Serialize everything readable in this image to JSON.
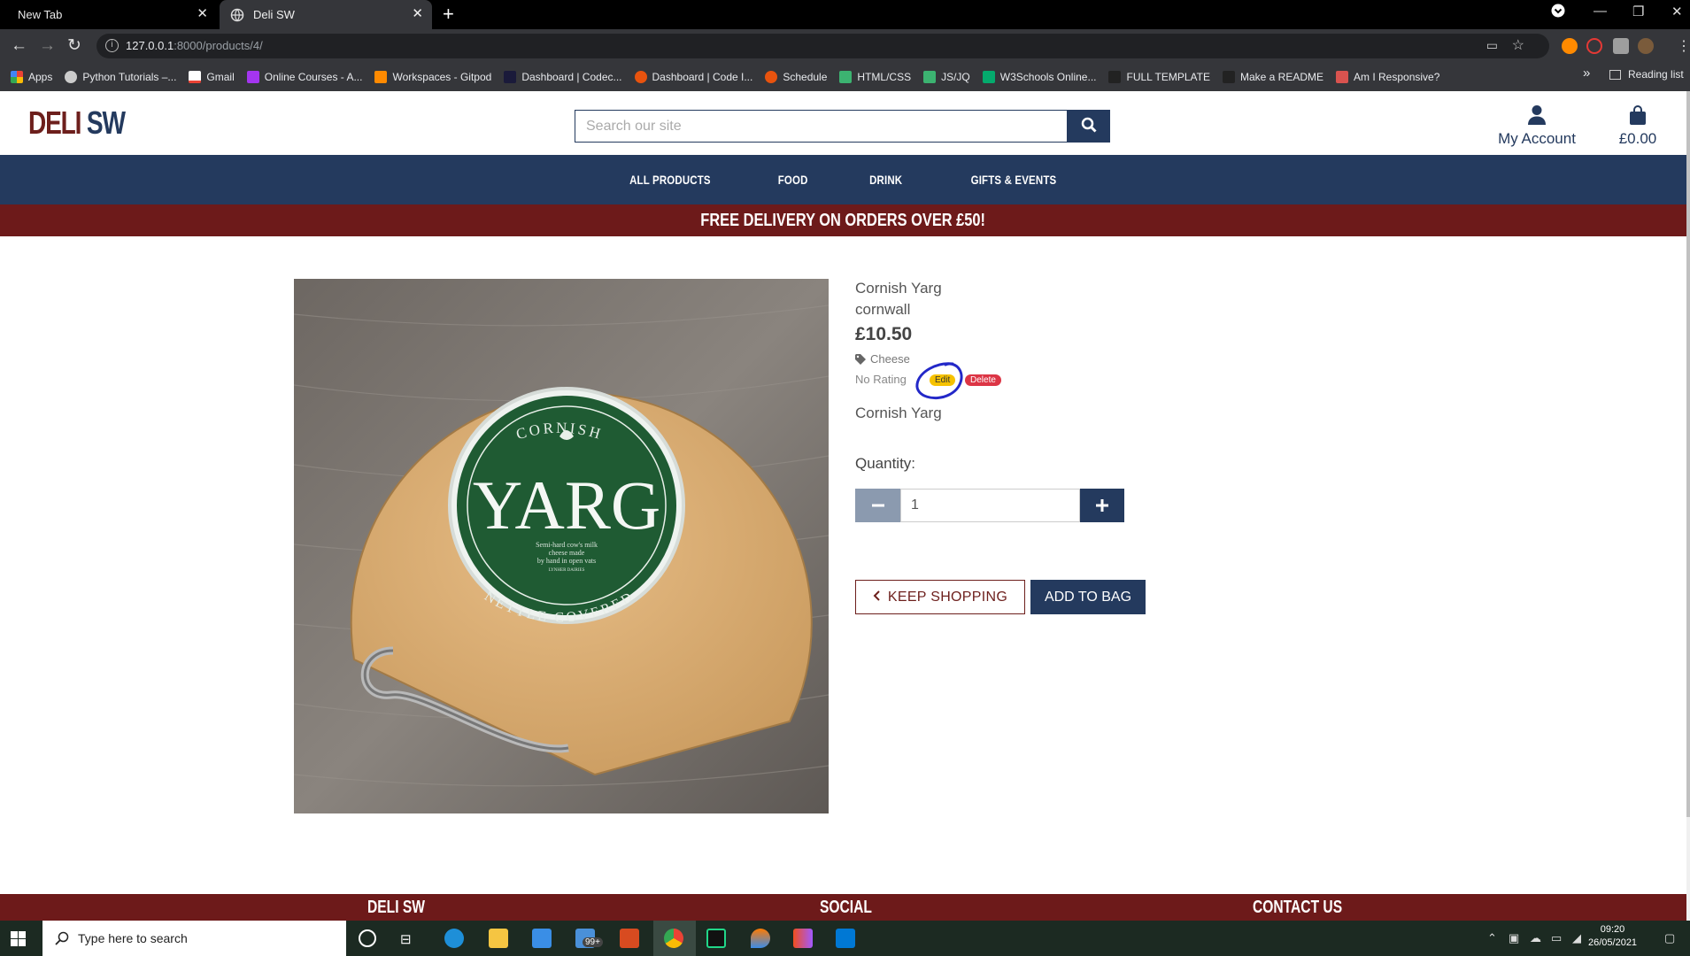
{
  "browser": {
    "tabs": [
      {
        "title": "New Tab"
      },
      {
        "title": "Deli SW"
      }
    ],
    "url_host": "127.0.0.1",
    "url_rest": ":8000/products/4/",
    "bookmarks": [
      {
        "label": "Apps",
        "color": "#4285f4"
      },
      {
        "label": "Python Tutorials –...",
        "color": "#cccccc"
      },
      {
        "label": "Gmail",
        "color": "#ea4335"
      },
      {
        "label": "Online Courses - A...",
        "color": "#a435f0"
      },
      {
        "label": "Workspaces - Gitpod",
        "color": "#ff8a00"
      },
      {
        "label": "Dashboard | Codec...",
        "color": "#1a1a3a"
      },
      {
        "label": "Dashboard | Code I...",
        "color": "#e8530e"
      },
      {
        "label": "Schedule",
        "color": "#e8530e"
      },
      {
        "label": "HTML/CSS",
        "color": "#3cb371"
      },
      {
        "label": "JS/JQ",
        "color": "#3cb371"
      },
      {
        "label": "W3Schools Online...",
        "color": "#04aa6d"
      },
      {
        "label": "FULL TEMPLATE",
        "color": "#222222"
      },
      {
        "label": "Make a README",
        "color": "#222222"
      },
      {
        "label": "Am I Responsive?",
        "color": "#d9534f"
      }
    ],
    "reading_list": "Reading list"
  },
  "site": {
    "logo_deli": "DELI",
    "logo_sw": "SW",
    "search_placeholder": "Search our site",
    "account_label": "My Account",
    "bag_total": "£0.00",
    "nav": [
      "ALL PRODUCTS",
      "FOOD",
      "DRINK",
      "GIFTS & EVENTS"
    ],
    "banner": "FREE DELIVERY ON ORDERS OVER £50!",
    "colors": {
      "navy": "#243a5e",
      "maroon": "#6d1a1a"
    }
  },
  "product": {
    "name": "Cornish Yarg",
    "region": "cornwall",
    "price": "£10.50",
    "category": "Cheese",
    "rating": "No Rating",
    "edit_label": "Edit",
    "delete_label": "Delete",
    "description": "Cornish Yarg",
    "quantity_label": "Quantity:",
    "quantity_value": "1",
    "keep_shopping": "KEEP SHOPPING",
    "add_to_bag": "ADD TO BAG",
    "image_text": {
      "top": "CORNISH",
      "main": "YARG",
      "small": [
        "Semi-hard cow's milk",
        "cheese made",
        "by hand in open vats",
        "LYNHER DAIRIES"
      ],
      "bottom": "NETTLE COVERED"
    }
  },
  "footer": {
    "col1": "DELI SW",
    "col2": "SOCIAL",
    "col3": "CONTACT US"
  },
  "taskbar": {
    "search_placeholder": "Type here to search",
    "time": "09:20",
    "date": "26/05/2021",
    "mail_badge": "99+"
  }
}
